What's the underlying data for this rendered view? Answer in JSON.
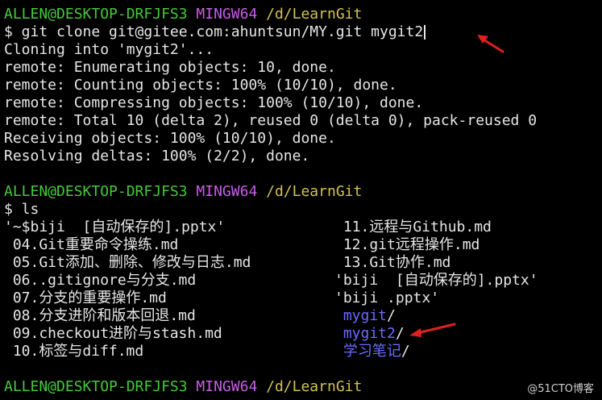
{
  "colors": {
    "user": "#46c93a",
    "shell": "#c85ee8",
    "path": "#d2c34f",
    "dir": "#6b6bff",
    "arrow": "#e02020"
  },
  "prompt": {
    "user": "ALLEN@DESKTOP-DRFJFS3",
    "shell": "MINGW64",
    "path": "/d/LearnGit"
  },
  "clone_command": "$ git clone git@gitee.com:ahuntsun/MY.git mygit2",
  "output": [
    "Cloning into 'mygit2'...",
    "remote: Enumerating objects: 10, done.",
    "remote: Counting objects: 100% (10/10), done.",
    "remote: Compressing objects: 100% (10/10), done.",
    "remote: Total 10 (delta 2), reused 0 (delta 0), pack-reused 0",
    "Receiving objects: 100% (10/10), done.",
    "Resolving deltas: 100% (2/2), done."
  ],
  "ls_command": "$ ls",
  "ls_col1": [
    "'~$biji  [自动保存的].pptx'",
    " 04.Git重要命令操练.md",
    " 05.Git添加、删除、修改与日志.md",
    " 06..gitignore与分支.md",
    " 07.分支的重要操作.md",
    " 08.分支进阶和版本回退.md",
    " 09.checkout进阶与stash.md",
    " 10.标签与diff.md"
  ],
  "ls_col2": [
    {
      "text": " 11.远程与Github.md",
      "dir": false,
      "suffix": ""
    },
    {
      "text": " 12.git远程操作.md",
      "dir": false,
      "suffix": ""
    },
    {
      "text": " 13.Git协作.md",
      "dir": false,
      "suffix": ""
    },
    {
      "text": "'biji  [自动保存的].pptx'",
      "dir": false,
      "suffix": ""
    },
    {
      "text": "'biji .pptx'",
      "dir": false,
      "suffix": ""
    },
    {
      "text": " mygit",
      "dir": true,
      "suffix": "/"
    },
    {
      "text": " mygit2",
      "dir": true,
      "suffix": "/"
    },
    {
      "text": " 学习笔记",
      "dir": true,
      "suffix": "/"
    }
  ],
  "watermark": "@51CTO博客"
}
